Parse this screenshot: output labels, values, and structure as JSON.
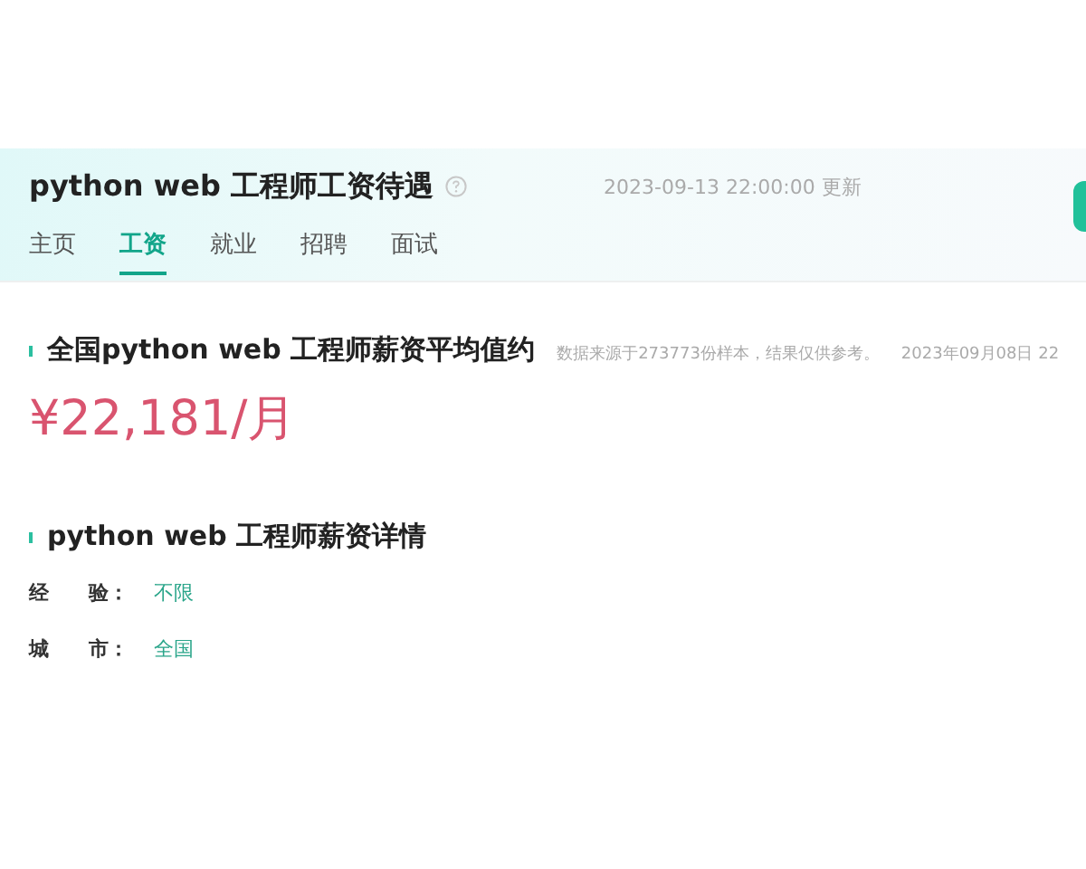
{
  "header": {
    "title": "python web 工程师工资待遇",
    "updated": "2023-09-13 22:00:00 更新"
  },
  "tabs": [
    {
      "label": "主页",
      "selected": false
    },
    {
      "label": "工资",
      "selected": true
    },
    {
      "label": "就业",
      "selected": false
    },
    {
      "label": "招聘",
      "selected": false
    },
    {
      "label": "面试",
      "selected": false
    }
  ],
  "average": {
    "heading": "全国python web 工程师薪资平均值约",
    "source": "数据来源于273773份样本，结果仅供参考。",
    "date": "2023年09月08日 22",
    "value": "¥22,181/月"
  },
  "details": {
    "heading": "python web 工程师薪资详情",
    "filters": [
      {
        "label": "经 验：",
        "value": "不限"
      },
      {
        "label": "城 市：",
        "value": "全国"
      }
    ]
  }
}
